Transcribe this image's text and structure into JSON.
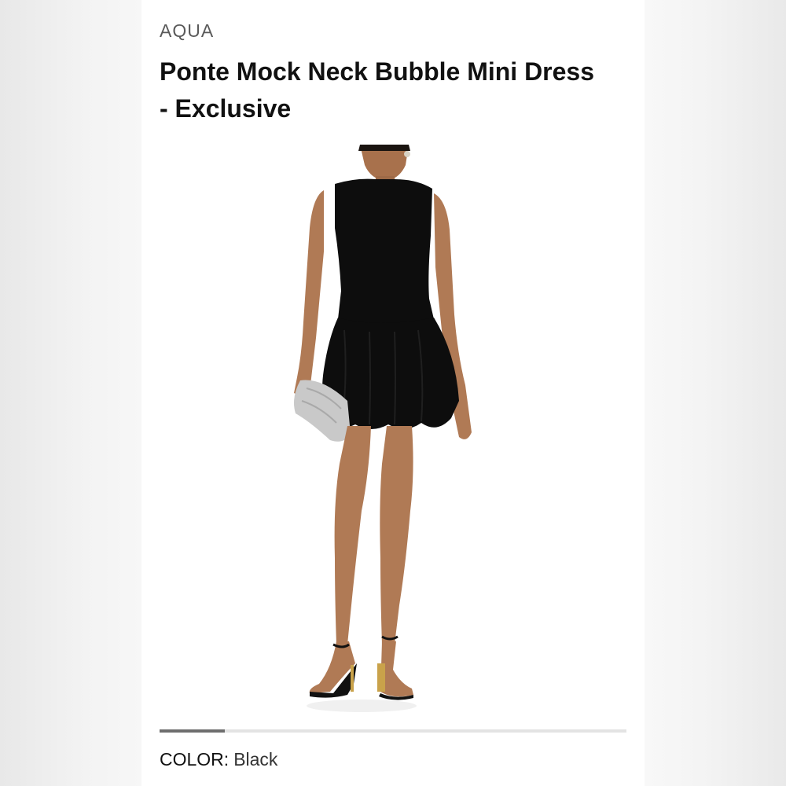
{
  "product": {
    "brand": "AQUA",
    "title": "Ponte Mock Neck Bubble Mini Dress - Exclusive",
    "image_alt": "Model wearing black sleeveless mock neck bubble mini dress holding a silver clutch"
  },
  "carousel": {
    "position_fraction": 0.14
  },
  "color": {
    "label": "COLOR:",
    "value": "Black"
  },
  "colors": {
    "dress": "#0d0d0d",
    "skin": "#b07a55",
    "clutch": "#c9c9c9"
  }
}
